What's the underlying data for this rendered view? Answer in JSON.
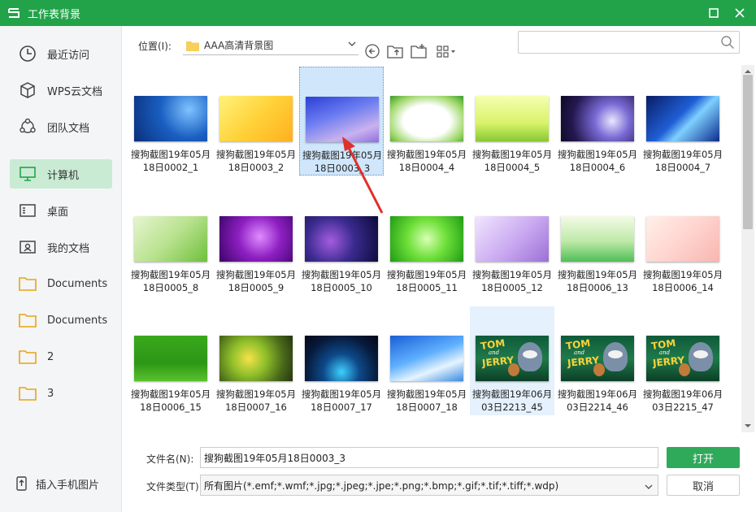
{
  "window": {
    "title": "工作表背景"
  },
  "sidebar": {
    "items": [
      {
        "label": "最近访问",
        "icon": "clock-icon"
      },
      {
        "label": "WPS云文档",
        "icon": "cube-icon"
      },
      {
        "label": "团队文档",
        "icon": "team-icon"
      },
      {
        "label": "计算机",
        "icon": "monitor-icon",
        "active": true
      },
      {
        "label": "桌面",
        "icon": "desktop-icon"
      },
      {
        "label": "我的文档",
        "icon": "my-docs-icon"
      },
      {
        "label": "Documents",
        "icon": "folder-icon"
      },
      {
        "label": "Documents",
        "icon": "folder-icon"
      },
      {
        "label": "2",
        "icon": "folder-icon"
      },
      {
        "label": "3",
        "icon": "folder-icon"
      }
    ],
    "bottom_label": "插入手机图片"
  },
  "toolbar": {
    "location_label": "位置(I):",
    "location_value": "AAA高清背景图",
    "search_placeholder": ""
  },
  "files": [
    {
      "line1": "搜狗截图19年05月",
      "line2": "18日0002_1",
      "theme": "blue-snow"
    },
    {
      "line1": "搜狗截图19年05月",
      "line2": "18日0003_2",
      "theme": "yellow"
    },
    {
      "line1": "搜狗截图19年05月",
      "line2": "18日0003_3",
      "theme": "purple-blue",
      "selected": true
    },
    {
      "line1": "搜狗截图19年05月",
      "line2": "18日0004_4",
      "theme": "green-leaf"
    },
    {
      "line1": "搜狗截图19年05月",
      "line2": "18日0004_5",
      "theme": "lime"
    },
    {
      "line1": "搜狗截图19年05月",
      "line2": "18日0004_6",
      "theme": "space"
    },
    {
      "line1": "搜狗截图19年05月",
      "line2": "18日0004_7",
      "theme": "deep-blue"
    },
    {
      "line1": "搜狗截图19年05月",
      "line2": "18日0005_8",
      "theme": "light-green"
    },
    {
      "line1": "搜狗截图19年05月",
      "line2": "18日0005_9",
      "theme": "violet"
    },
    {
      "line1": "搜狗截图19年05月",
      "line2": "18日0005_10",
      "theme": "bubbles"
    },
    {
      "line1": "搜狗截图19年05月",
      "line2": "18日0005_11",
      "theme": "bright-green"
    },
    {
      "line1": "搜狗截图19年05月",
      "line2": "18日0005_12",
      "theme": "lavender"
    },
    {
      "line1": "搜狗截图19年05月",
      "line2": "18日0006_13",
      "theme": "mint"
    },
    {
      "line1": "搜狗截图19年05月",
      "line2": "18日0006_14",
      "theme": "floral"
    },
    {
      "line1": "搜狗截图19年05月",
      "line2": "18日0006_15",
      "theme": "grass"
    },
    {
      "line1": "搜狗截图19年05月",
      "line2": "18日0007_16",
      "theme": "bokeh"
    },
    {
      "line1": "搜狗截图19年05月",
      "line2": "18日0007_17",
      "theme": "night"
    },
    {
      "line1": "搜狗截图19年05月",
      "line2": "18日0007_18",
      "theme": "sky"
    },
    {
      "line1": "搜狗截图19年06月",
      "line2": "03日2213_45",
      "theme": "tom-jerry",
      "hovered": true
    },
    {
      "line1": "搜狗截图19年06月",
      "line2": "03日2214_46",
      "theme": "tom-jerry"
    },
    {
      "line1": "搜狗截图19年06月",
      "line2": "03日2215_47",
      "theme": "tom-jerry"
    }
  ],
  "bottom": {
    "filename_label": "文件名(N):",
    "filename_value": "搜狗截图19年05月18日0003_3",
    "filetype_label": "文件类型(T):",
    "filetype_value": "所有图片(*.emf;*.wmf;*.jpg;*.jpeg;*.jpe;*.png;*.bmp;*.gif;*.tif;*.tiff;*.wdp)",
    "open_label": "打开",
    "cancel_label": "取消"
  },
  "tom_jerry_text": {
    "top": "TOM",
    "mid": "and",
    "bottom": "JERRY"
  },
  "colors": {
    "accent": "#22a34a",
    "active_bg": "#c9ebd3",
    "selection": "#cfe6fb",
    "annotation": "#e0302a"
  }
}
